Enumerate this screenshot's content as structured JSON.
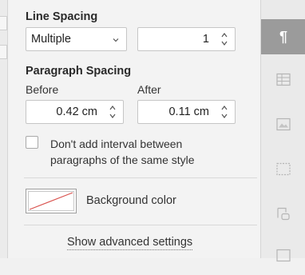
{
  "line_spacing": {
    "heading": "Line Spacing",
    "mode": "Multiple",
    "value": "1"
  },
  "paragraph_spacing": {
    "heading": "Paragraph Spacing",
    "before_label": "Before",
    "before_value": "0.42 cm",
    "after_label": "After",
    "after_value": "0.11 cm"
  },
  "no_interval": {
    "label_line1": "Don't add interval between",
    "label_line2": "paragraphs of the same style",
    "checked": false
  },
  "background": {
    "label": "Background color",
    "swatch": "none"
  },
  "advanced_link": "Show advanced settings",
  "colors": {
    "active_tab": "#9b9b9b",
    "swatch_slash": "#d9534f"
  },
  "rail": {
    "tabs": [
      "paragraph-icon",
      "table-icon",
      "image-icon",
      "header-footer-icon",
      "shape-icon",
      "chart-icon"
    ],
    "active": "paragraph-icon"
  }
}
